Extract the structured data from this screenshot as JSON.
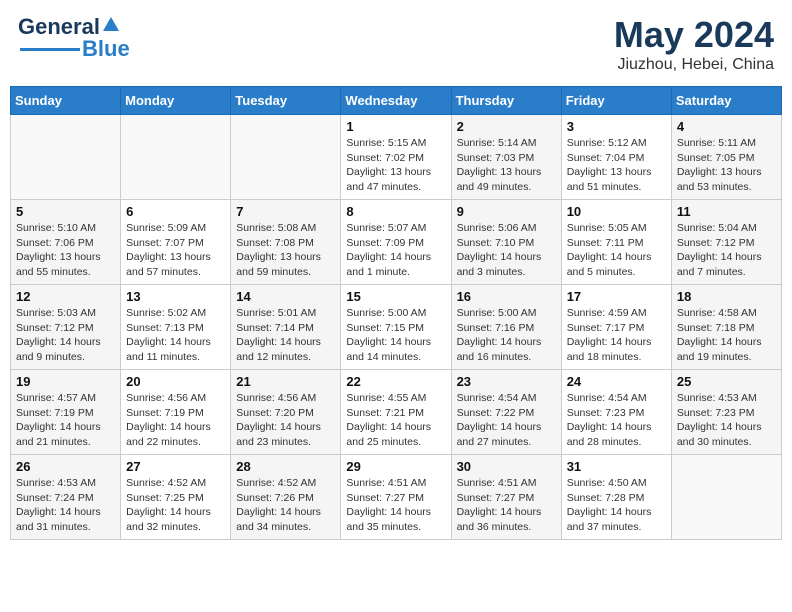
{
  "header": {
    "logo_general": "General",
    "logo_blue": "Blue",
    "month_title": "May 2024",
    "location": "Jiuzhou, Hebei, China"
  },
  "days_of_week": [
    "Sunday",
    "Monday",
    "Tuesday",
    "Wednesday",
    "Thursday",
    "Friday",
    "Saturday"
  ],
  "weeks": [
    {
      "days": [
        {
          "num": "",
          "info": ""
        },
        {
          "num": "",
          "info": ""
        },
        {
          "num": "",
          "info": ""
        },
        {
          "num": "1",
          "info": "Sunrise: 5:15 AM\nSunset: 7:02 PM\nDaylight: 13 hours and 47 minutes."
        },
        {
          "num": "2",
          "info": "Sunrise: 5:14 AM\nSunset: 7:03 PM\nDaylight: 13 hours and 49 minutes."
        },
        {
          "num": "3",
          "info": "Sunrise: 5:12 AM\nSunset: 7:04 PM\nDaylight: 13 hours and 51 minutes."
        },
        {
          "num": "4",
          "info": "Sunrise: 5:11 AM\nSunset: 7:05 PM\nDaylight: 13 hours and 53 minutes."
        }
      ]
    },
    {
      "days": [
        {
          "num": "5",
          "info": "Sunrise: 5:10 AM\nSunset: 7:06 PM\nDaylight: 13 hours and 55 minutes."
        },
        {
          "num": "6",
          "info": "Sunrise: 5:09 AM\nSunset: 7:07 PM\nDaylight: 13 hours and 57 minutes."
        },
        {
          "num": "7",
          "info": "Sunrise: 5:08 AM\nSunset: 7:08 PM\nDaylight: 13 hours and 59 minutes."
        },
        {
          "num": "8",
          "info": "Sunrise: 5:07 AM\nSunset: 7:09 PM\nDaylight: 14 hours and 1 minute."
        },
        {
          "num": "9",
          "info": "Sunrise: 5:06 AM\nSunset: 7:10 PM\nDaylight: 14 hours and 3 minutes."
        },
        {
          "num": "10",
          "info": "Sunrise: 5:05 AM\nSunset: 7:11 PM\nDaylight: 14 hours and 5 minutes."
        },
        {
          "num": "11",
          "info": "Sunrise: 5:04 AM\nSunset: 7:12 PM\nDaylight: 14 hours and 7 minutes."
        }
      ]
    },
    {
      "days": [
        {
          "num": "12",
          "info": "Sunrise: 5:03 AM\nSunset: 7:12 PM\nDaylight: 14 hours and 9 minutes."
        },
        {
          "num": "13",
          "info": "Sunrise: 5:02 AM\nSunset: 7:13 PM\nDaylight: 14 hours and 11 minutes."
        },
        {
          "num": "14",
          "info": "Sunrise: 5:01 AM\nSunset: 7:14 PM\nDaylight: 14 hours and 12 minutes."
        },
        {
          "num": "15",
          "info": "Sunrise: 5:00 AM\nSunset: 7:15 PM\nDaylight: 14 hours and 14 minutes."
        },
        {
          "num": "16",
          "info": "Sunrise: 5:00 AM\nSunset: 7:16 PM\nDaylight: 14 hours and 16 minutes."
        },
        {
          "num": "17",
          "info": "Sunrise: 4:59 AM\nSunset: 7:17 PM\nDaylight: 14 hours and 18 minutes."
        },
        {
          "num": "18",
          "info": "Sunrise: 4:58 AM\nSunset: 7:18 PM\nDaylight: 14 hours and 19 minutes."
        }
      ]
    },
    {
      "days": [
        {
          "num": "19",
          "info": "Sunrise: 4:57 AM\nSunset: 7:19 PM\nDaylight: 14 hours and 21 minutes."
        },
        {
          "num": "20",
          "info": "Sunrise: 4:56 AM\nSunset: 7:19 PM\nDaylight: 14 hours and 22 minutes."
        },
        {
          "num": "21",
          "info": "Sunrise: 4:56 AM\nSunset: 7:20 PM\nDaylight: 14 hours and 23 minutes."
        },
        {
          "num": "22",
          "info": "Sunrise: 4:55 AM\nSunset: 7:21 PM\nDaylight: 14 hours and 25 minutes."
        },
        {
          "num": "23",
          "info": "Sunrise: 4:54 AM\nSunset: 7:22 PM\nDaylight: 14 hours and 27 minutes."
        },
        {
          "num": "24",
          "info": "Sunrise: 4:54 AM\nSunset: 7:23 PM\nDaylight: 14 hours and 28 minutes."
        },
        {
          "num": "25",
          "info": "Sunrise: 4:53 AM\nSunset: 7:23 PM\nDaylight: 14 hours and 30 minutes."
        }
      ]
    },
    {
      "days": [
        {
          "num": "26",
          "info": "Sunrise: 4:53 AM\nSunset: 7:24 PM\nDaylight: 14 hours and 31 minutes."
        },
        {
          "num": "27",
          "info": "Sunrise: 4:52 AM\nSunset: 7:25 PM\nDaylight: 14 hours and 32 minutes."
        },
        {
          "num": "28",
          "info": "Sunrise: 4:52 AM\nSunset: 7:26 PM\nDaylight: 14 hours and 34 minutes."
        },
        {
          "num": "29",
          "info": "Sunrise: 4:51 AM\nSunset: 7:27 PM\nDaylight: 14 hours and 35 minutes."
        },
        {
          "num": "30",
          "info": "Sunrise: 4:51 AM\nSunset: 7:27 PM\nDaylight: 14 hours and 36 minutes."
        },
        {
          "num": "31",
          "info": "Sunrise: 4:50 AM\nSunset: 7:28 PM\nDaylight: 14 hours and 37 minutes."
        },
        {
          "num": "",
          "info": ""
        }
      ]
    }
  ]
}
